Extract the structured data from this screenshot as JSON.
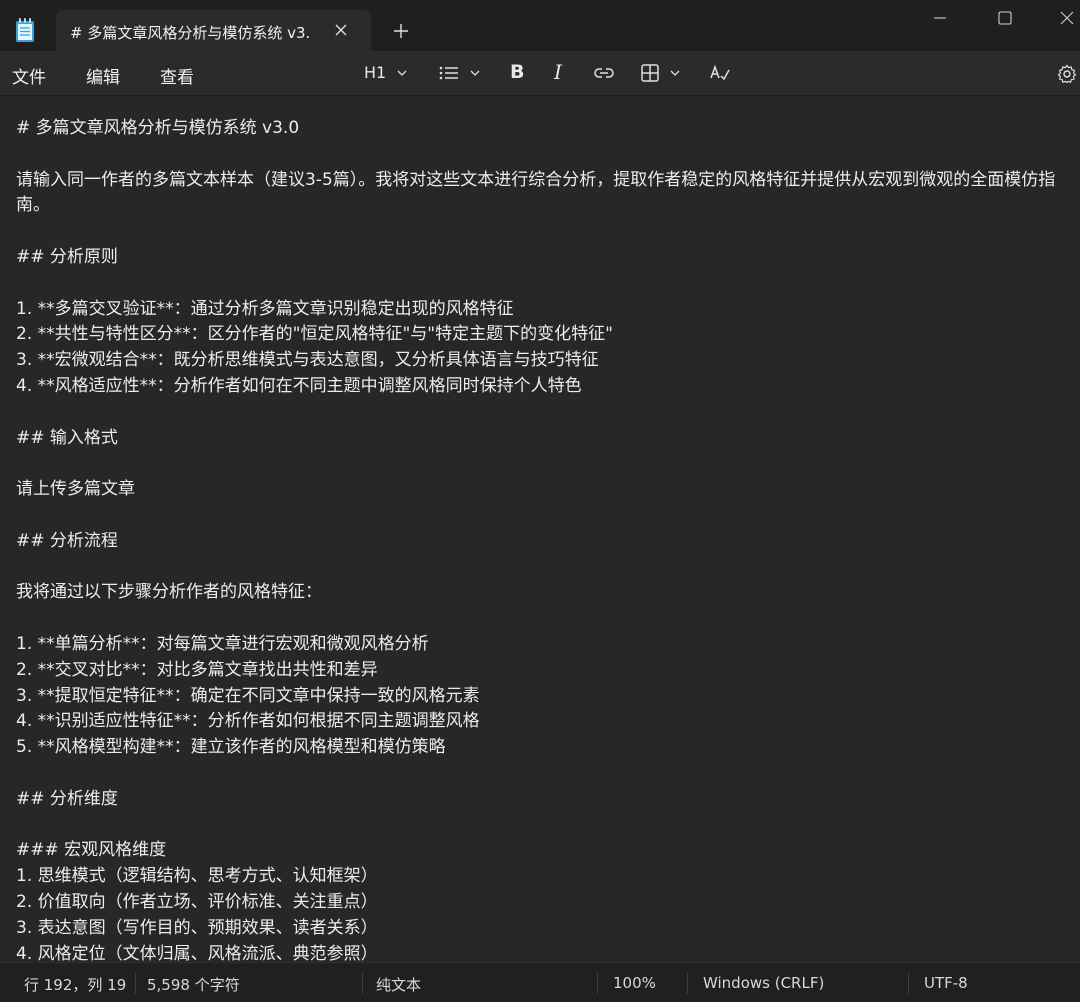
{
  "tab": {
    "title": "# 多篇文章风格分析与模仿系统 v3."
  },
  "menu": {
    "file": "文件",
    "edit": "编辑",
    "view": "查看"
  },
  "toolbar": {
    "heading": "H1"
  },
  "editor": {
    "text": "# 多篇文章风格分析与模仿系统 v3.0\n\n请输入同一作者的多篇文本样本（建议3-5篇）。我将对这些文本进行综合分析，提取作者稳定的风格特征并提供从宏观到微观的全面模仿指南。\n\n## 分析原则\n\n1. **多篇交叉验证**：通过分析多篇文章识别稳定出现的风格特征\n2. **共性与特性区分**：区分作者的\"恒定风格特征\"与\"特定主题下的变化特征\"\n3. **宏微观结合**：既分析思维模式与表达意图，又分析具体语言与技巧特征\n4. **风格适应性**：分析作者如何在不同主题中调整风格同时保持个人特色\n\n## 输入格式\n\n请上传多篇文章\n\n## 分析流程\n\n我将通过以下步骤分析作者的风格特征：\n\n1. **单篇分析**：对每篇文章进行宏观和微观风格分析\n2. **交叉对比**：对比多篇文章找出共性和差异\n3. **提取恒定特征**：确定在不同文章中保持一致的风格元素\n4. **识别适应性特征**：分析作者如何根据不同主题调整风格\n5. **风格模型构建**：建立该作者的风格模型和模仿策略\n\n## 分析维度\n\n### 宏观风格维度\n1. 思维模式（逻辑结构、思考方式、认知框架）\n2. 价值取向（作者立场、评价标准、关注重点）\n3. 表达意图（写作目的、预期效果、读者关系）\n4. 风格定位（文体归属、风格流派、典范参照）"
  },
  "status": {
    "position": "行 192，列 19",
    "chars": "5,598 个字符",
    "type": "纯文本",
    "zoom": "100%",
    "eol": "Windows (CRLF)",
    "encoding": "UTF-8"
  }
}
